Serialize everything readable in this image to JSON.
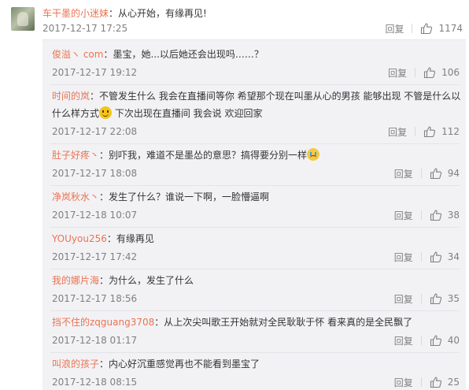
{
  "main": {
    "user": "车干墨的小迷妹",
    "sep": "：",
    "text": "从心开始，有缘再见!",
    "time": "2017-12-17 17:25",
    "reply_label": "回复",
    "likes": "1174"
  },
  "replies": [
    {
      "user": "俊溢ヽ com",
      "sep": "：",
      "text": "墨宝，她...以后她还会出现吗……？",
      "time": "2017-12-17 19:12",
      "reply_label": "回复",
      "likes": "106"
    },
    {
      "user": "时间的岚",
      "sep": "：",
      "text": "不管发生什么 我会在直播间等你 希望那个现在叫墨从心的男孩 能够出现 不管是什么以什么样方式",
      "text2": " 下次出现在直播间 我会说 欢迎回家",
      "time": "2017-12-17 22:08",
      "reply_label": "回复",
      "likes": "112"
    },
    {
      "user": "肚子好疼丶",
      "sep": "：",
      "text": "别吓我，难道不是墨怂的意思？搞得要分别一样",
      "time": "2017-12-17 18:08",
      "reply_label": "回复",
      "likes": "94"
    },
    {
      "user": "净岚秋水丶",
      "sep": "：",
      "text": "发生了什么？谁说一下啊，一脸懵逼啊",
      "time": "2017-12-18 10:07",
      "reply_label": "回复",
      "likes": "38"
    },
    {
      "user": "YOUyou256",
      "sep": "：",
      "text": "有缘再见",
      "time": "2017-12-17 17:42",
      "reply_label": "回复",
      "likes": "34"
    },
    {
      "user": "我的娜片海",
      "sep": "：",
      "text": "为什么，发生了什么",
      "time": "2017-12-17 18:56",
      "reply_label": "回复",
      "likes": "35"
    },
    {
      "user": "挡不住的zqguang3708",
      "sep": "：",
      "text": "从上次尖叫歌王开始就对全民耿耿于怀  看来真的是全民飘了",
      "time": "2017-12-18 01:17",
      "reply_label": "回复",
      "likes": "40"
    },
    {
      "user": "叫浪的孩子",
      "sep": "：",
      "text": "内心好沉重感觉再也不能看到墨宝了",
      "time": "2017-12-18 08:15",
      "reply_label": "回复",
      "likes": "25"
    }
  ]
}
